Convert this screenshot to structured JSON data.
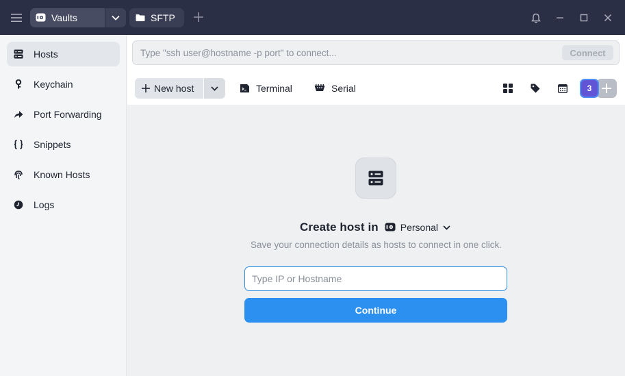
{
  "titlebar": {
    "vault_tab_label": "Vaults",
    "sftp_tab_label": "SFTP",
    "icons": [
      "hamburger-icon",
      "vault-icon",
      "chevron-down-icon",
      "folder-icon",
      "plus-icon",
      "bell-icon",
      "minimize-icon",
      "maximize-icon",
      "close-icon"
    ]
  },
  "sidebar": {
    "items": [
      {
        "label": "Hosts",
        "icon": "server-icon",
        "active": true
      },
      {
        "label": "Keychain",
        "icon": "key-icon",
        "active": false
      },
      {
        "label": "Port Forwarding",
        "icon": "arrow-forward-icon",
        "active": false
      },
      {
        "label": "Snippets",
        "icon": "braces-icon",
        "active": false
      },
      {
        "label": "Known Hosts",
        "icon": "fingerprint-icon",
        "active": false
      },
      {
        "label": "Logs",
        "icon": "clock-icon",
        "active": false
      }
    ]
  },
  "quick_connect": {
    "placeholder": "Type \"ssh user@hostname -p port\" to connect...",
    "button_label": "Connect"
  },
  "toolbar": {
    "new_host_label": "New host",
    "terminal_label": "Terminal",
    "serial_label": "Serial",
    "avatar_count": "3"
  },
  "empty_state": {
    "title": "Create host in",
    "vault_name": "Personal",
    "subtitle": "Save your connection details as hosts to connect in one click.",
    "input_placeholder": "Type IP or Hostname",
    "continue_label": "Continue"
  },
  "colors": {
    "titlebar_bg": "#2b2f45",
    "accent_blue": "#2b90f0",
    "avatar_purple": "#6155d6"
  }
}
